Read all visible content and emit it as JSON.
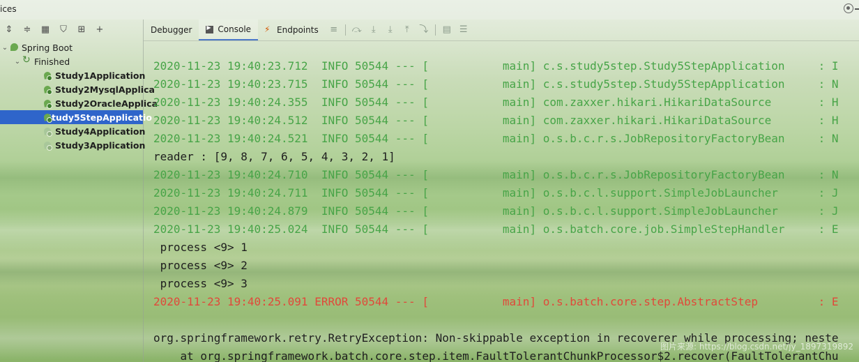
{
  "window": {
    "title": "ices"
  },
  "left_toolbar": {
    "icons": [
      "expand-all-icon",
      "collapse-all-icon",
      "group-icon",
      "filter-icon",
      "add-config-icon",
      "add-icon"
    ]
  },
  "tree": {
    "root": {
      "label": "Spring Boot"
    },
    "group": {
      "label": "Finished"
    },
    "apps": [
      {
        "label": "Study1Application"
      },
      {
        "label": "Study2MysqlApplica"
      },
      {
        "label": "Study2OracleApplica"
      },
      {
        "label": "Study5StepApplicatio"
      },
      {
        "label": "Study4Application"
      },
      {
        "label": "Study3Application"
      }
    ]
  },
  "right_toolbar": {
    "tabs": [
      {
        "label": "Debugger"
      },
      {
        "label": "Console"
      },
      {
        "label": "Endpoints"
      }
    ]
  },
  "console": {
    "lines": [
      {
        "text": "2020-11-23 19:40:23.712  INFO 50544 --- [           main] c.s.study5step.Study5StepApplication     : I"
      },
      {
        "text": "2020-11-23 19:40:23.715  INFO 50544 --- [           main] c.s.study5step.Study5StepApplication     : N"
      },
      {
        "text": "2020-11-23 19:40:24.355  INFO 50544 --- [           main] com.zaxxer.hikari.HikariDataSource       : H"
      },
      {
        "text": "2020-11-23 19:40:24.512  INFO 50544 --- [           main] com.zaxxer.hikari.HikariDataSource       : H"
      },
      {
        "text": "2020-11-23 19:40:24.521  INFO 50544 --- [           main] o.s.b.c.r.s.JobRepositoryFactoryBean     : N"
      },
      {
        "text": "reader : [9, 8, 7, 6, 5, 4, 3, 2, 1]"
      },
      {
        "text": "2020-11-23 19:40:24.710  INFO 50544 --- [           main] o.s.b.c.r.s.JobRepositoryFactoryBean     : N"
      },
      {
        "text": "2020-11-23 19:40:24.711  INFO 50544 --- [           main] o.s.b.c.l.support.SimpleJobLauncher      : J"
      },
      {
        "text": "2020-11-23 19:40:24.879  INFO 50544 --- [           main] o.s.b.c.l.support.SimpleJobLauncher      : J"
      },
      {
        "text": "2020-11-23 19:40:25.024  INFO 50544 --- [           main] o.s.batch.core.job.SimpleStepHandler     : E"
      },
      {
        "text": " process <9> 1"
      },
      {
        "text": " process <9> 2"
      },
      {
        "text": " process <9> 3"
      },
      {
        "text": "2020-11-23 19:40:25.091 ERROR 50544 --- [           main] o.s.batch.core.step.AbstractStep         : E"
      },
      {
        "text": ""
      },
      {
        "text": "org.springframework.retry.RetryException: Non-skippable exception in recoverer while processing; neste"
      },
      {
        "text": "    at org.springframework.batch.core.step.item.FaultTolerantChunkProcessor$2.recover(FaultTolerantChu"
      }
    ],
    "watermark": "图片来源: https://blog.csdn.net/jy_1897319892"
  },
  "colors": {
    "info": "#47a447",
    "error": "#e0493a",
    "selection": "#2f65ca"
  }
}
